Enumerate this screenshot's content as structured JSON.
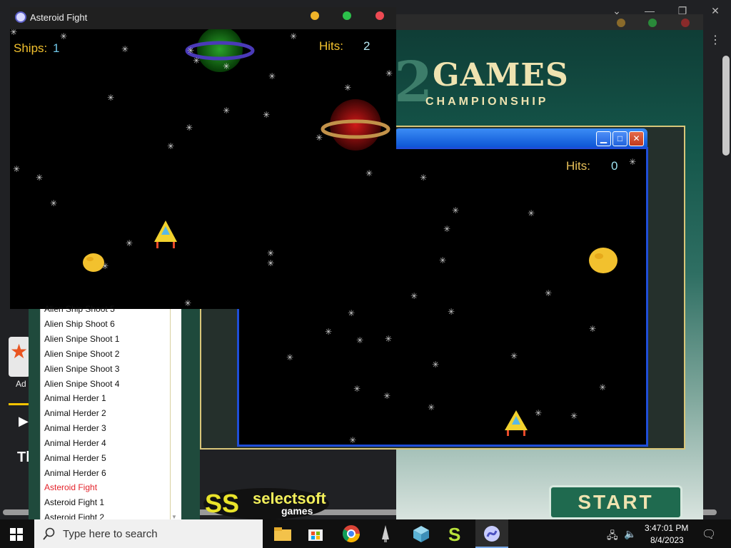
{
  "asteroid_window": {
    "title": "Asteroid Fight",
    "ships_label": "Ships:",
    "ships_value": "1",
    "hits_label": "Hits:",
    "hits_value": "2"
  },
  "background_game": {
    "hits_label": "Hits:",
    "hits_value": "0"
  },
  "championship": {
    "logo_number": "2",
    "logo_title": "GAMES",
    "logo_subtitle": "CHAMPIONSHIP",
    "start_label": "START"
  },
  "publisher": {
    "name_line1": "selectsoft",
    "name_line2": "games"
  },
  "game_list": {
    "items": [
      "Alien Ship Shoot 5",
      "Alien Ship Shoot 6",
      "Alien Snipe Shoot 1",
      "Alien Snipe Shoot 2",
      "Alien Snipe Shoot 3",
      "Alien Snipe Shoot 4",
      "Animal Herder 1",
      "Animal Herder 2",
      "Animal Herder 3",
      "Animal Herder 4",
      "Animal Herder 5",
      "Animal Herder 6",
      "Asteroid Fight",
      "Asteroid Fight 1",
      "Asteroid Fight 2"
    ],
    "selected": "Asteroid Fight"
  },
  "browser_side": {
    "ad_label": "Ad",
    "title_fragment": "Tl"
  },
  "taskbar": {
    "search_placeholder": "Type here to search",
    "time": "3:47:01 PM",
    "date": "8/4/2023"
  },
  "colors": {
    "hud_yellow": "#f2c12e",
    "hud_cyan": "#6fc6e8",
    "list_selected": "#e3232b",
    "xp_blue": "#1f4ed8"
  }
}
